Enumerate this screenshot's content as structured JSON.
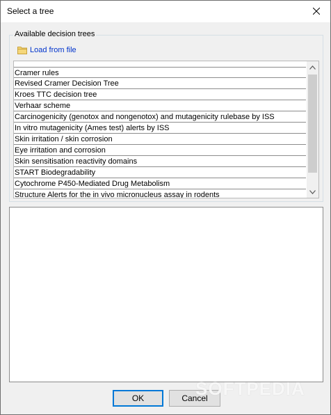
{
  "window": {
    "title": "Select a tree",
    "close_icon": "close-icon"
  },
  "group": {
    "caption": "Available decision trees",
    "load_link": "Load from file",
    "load_icon": "folder-icon"
  },
  "trees": [
    "Cramer rules",
    "Revised Cramer Decision Tree",
    "Kroes TTC decision tree",
    "Verhaar scheme",
    "Carcinogenicity (genotox and nongenotox) and mutagenicity rulebase by ISS",
    "In vitro mutagenicity (Ames test) alerts by ISS",
    "Skin irritation / skin corrosion",
    "Eye irritation and corrosion",
    "Skin sensitisation reactivity domains",
    "START Biodegradability",
    "Cytochrome P450-Mediated Drug Metabolism",
    "Structure Alerts for the in vivo micronucleus assay in rodents"
  ],
  "buttons": {
    "ok": "OK",
    "cancel": "Cancel"
  },
  "watermark": "SOFTPEDIA",
  "colors": {
    "link": "#0033cc",
    "ok_border": "#0078d7",
    "folder": "#e8c35a"
  }
}
